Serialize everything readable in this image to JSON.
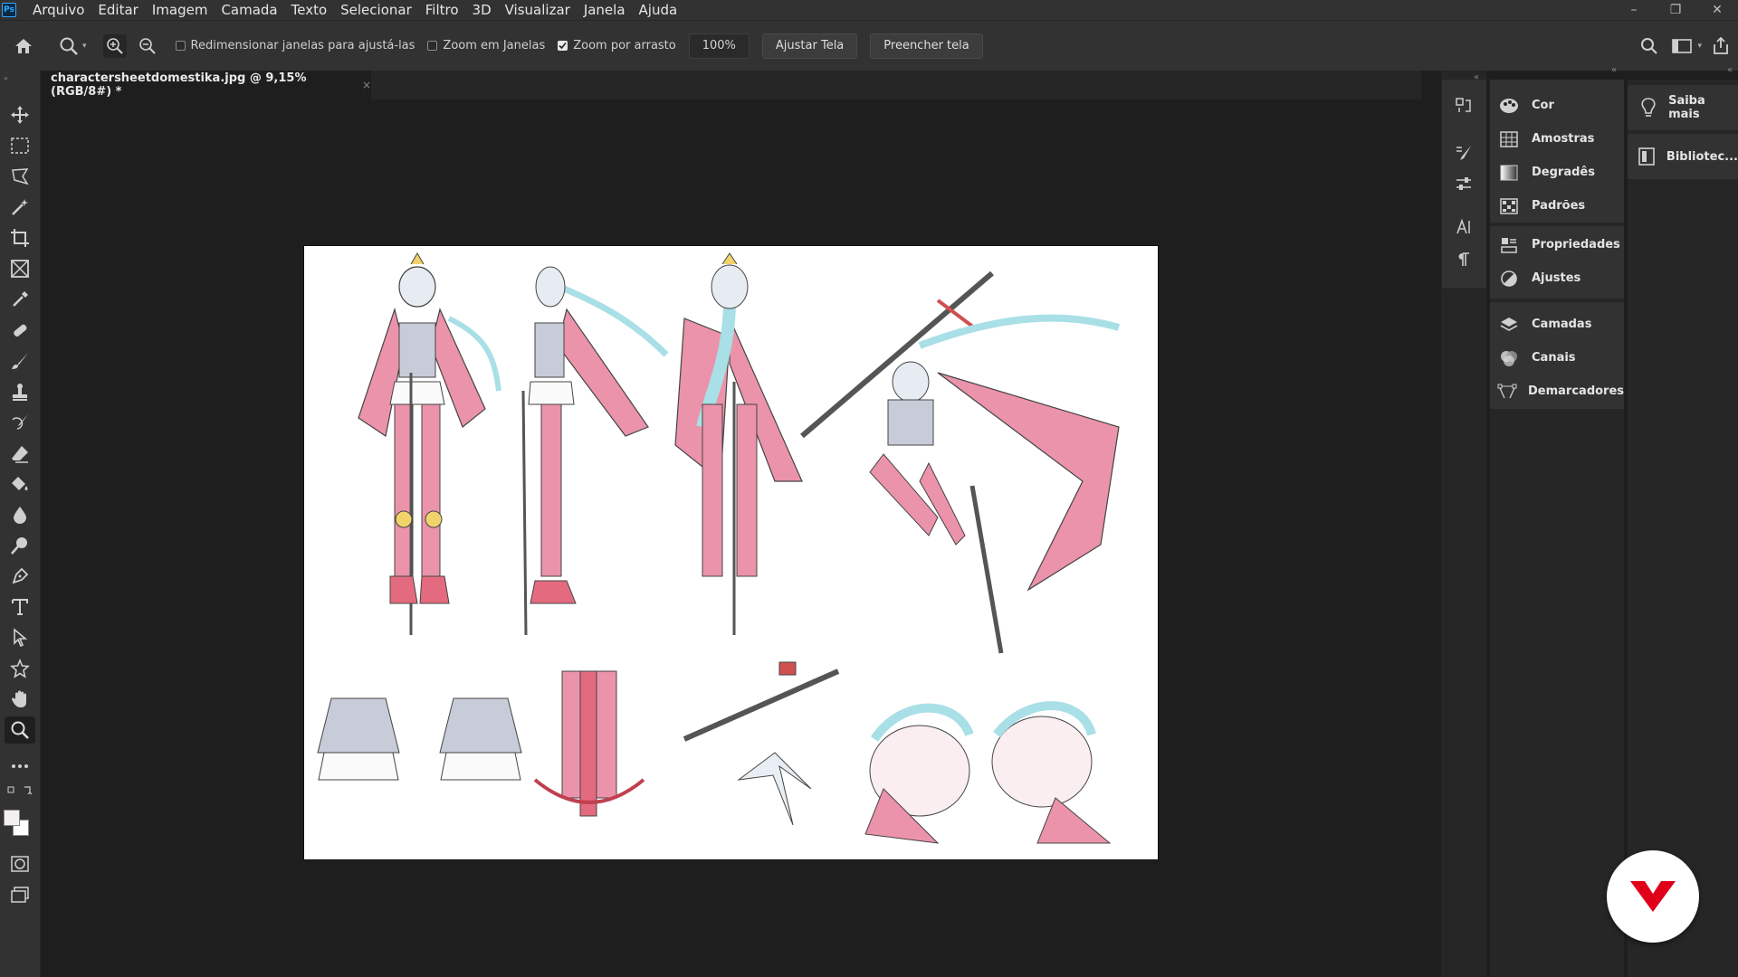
{
  "app": {
    "logo_text": "Ps"
  },
  "menu": [
    "Arquivo",
    "Editar",
    "Imagem",
    "Camada",
    "Texto",
    "Selecionar",
    "Filtro",
    "3D",
    "Visualizar",
    "Janela",
    "Ajuda"
  ],
  "window_controls": {
    "minimize": "–",
    "restore": "❐",
    "close": "✕"
  },
  "options": {
    "resize_windows_label": "Redimensionar janelas para ajustá-las",
    "resize_windows_checked": false,
    "zoom_all_windows_label": "Zoom em Janelas",
    "zoom_all_windows_checked": false,
    "scrubby_zoom_label": "Zoom por arrasto",
    "scrubby_zoom_checked": true,
    "zoom_value": "100%",
    "fit_screen_label": "Ajustar Tela",
    "fill_screen_label": "Preencher tela"
  },
  "document_tab": {
    "title": "charactersheetdomestika.jpg @ 9,15% (RGB/8#) *",
    "close": "×"
  },
  "panels": {
    "group1": [
      "Cor",
      "Amostras",
      "Degradês",
      "Padrões"
    ],
    "group2": [
      "Propriedades",
      "Ajustes"
    ],
    "group3": [
      "Camadas",
      "Canais",
      "Demarcadores"
    ]
  },
  "learn": {
    "learn_label": "Saiba mais",
    "libraries_label": "Bibliotec..."
  },
  "colors": {
    "accent": "#31a8ff",
    "badge_red": "#e1001a",
    "art_pink": "#e98aa3",
    "art_cyan": "#a9dfe6"
  }
}
